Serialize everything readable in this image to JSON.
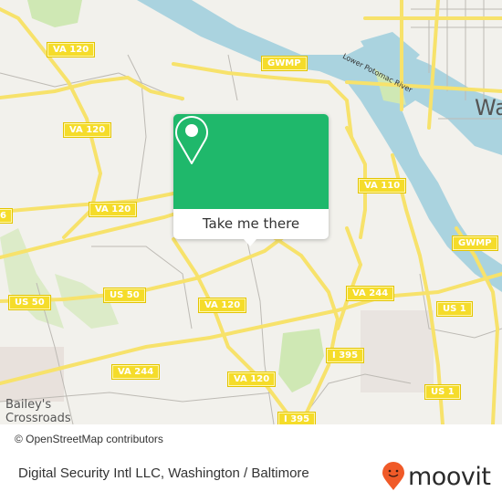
{
  "map": {
    "attribution": "© OpenStreetMap contributors",
    "place_labels": {
      "washington": "Wa",
      "baileys_line1": "Bailey's",
      "baileys_line2": "Crossroads",
      "river": "Lower Potomac River"
    },
    "road_shields": [
      {
        "id": "va120-a",
        "label": "VA 120"
      },
      {
        "id": "va120-b",
        "label": "VA 120"
      },
      {
        "id": "va120-c",
        "label": "VA 120"
      },
      {
        "id": "va120-d",
        "label": "VA 120"
      },
      {
        "id": "va120-e",
        "label": "VA 120"
      },
      {
        "id": "gwmp-a",
        "label": "GWMP"
      },
      {
        "id": "gwmp-b",
        "label": "GWMP"
      },
      {
        "id": "va110",
        "label": "VA 110"
      },
      {
        "id": "us50-a",
        "label": "US 50"
      },
      {
        "id": "us50-b",
        "label": "US 50"
      },
      {
        "id": "va244-a",
        "label": "VA 244"
      },
      {
        "id": "va244-b",
        "label": "VA 244"
      },
      {
        "id": "i395-a",
        "label": "I 395"
      },
      {
        "id": "i395-b",
        "label": "I 395"
      },
      {
        "id": "us1-a",
        "label": "US 1"
      },
      {
        "id": "us1-b",
        "label": "US 1"
      },
      {
        "id": "edge-6",
        "label": "6"
      }
    ],
    "colors": {
      "land": "#f2f1ec",
      "water": "#aad3df",
      "park": "#cfe8b4",
      "road": "#f7e26b",
      "shield": "#f5dc2a"
    }
  },
  "popup": {
    "icon": "location-pin-icon",
    "button_label": "Take me there",
    "accent": "#1fb86b"
  },
  "footer": {
    "title": "Digital Security Intl LLC, Washington / Baltimore",
    "brand": "moovit",
    "brand_color": "#f05a28"
  }
}
